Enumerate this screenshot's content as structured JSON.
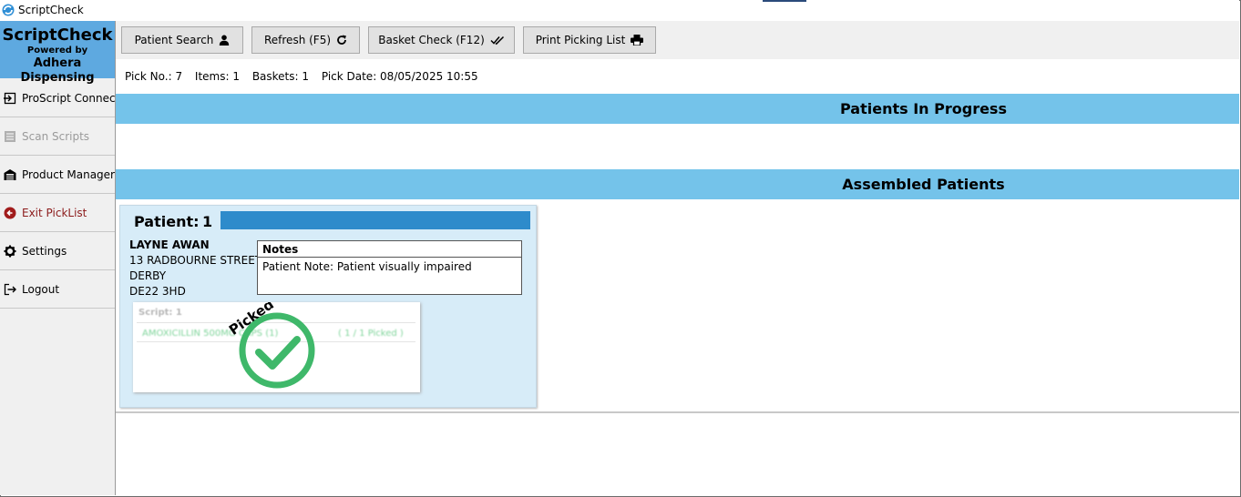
{
  "window": {
    "title": "ScriptCheck"
  },
  "brand": {
    "name": "ScriptCheck",
    "powered": "Powered by",
    "company": "Adhera Dispensing"
  },
  "sidebar": {
    "items": [
      {
        "label": "ProScript Connect",
        "icon": "login-arrow-icon",
        "enabled": true
      },
      {
        "label": "Scan Scripts",
        "icon": "barcode-list-icon",
        "enabled": false
      },
      {
        "label": "Product Manager",
        "icon": "warehouse-icon",
        "enabled": true
      },
      {
        "label": "Exit PickList",
        "icon": "back-circle-icon",
        "enabled": true
      },
      {
        "label": "Settings",
        "icon": "gear-icon",
        "enabled": true
      },
      {
        "label": "Logout",
        "icon": "logout-icon",
        "enabled": true
      }
    ]
  },
  "toolbar": {
    "patient_search": "Patient Search",
    "refresh": "Refresh (F5)",
    "basket_check": "Basket Check (F12)",
    "print_picking": "Print Picking List"
  },
  "pick": {
    "pick_no": "Pick No.: 7",
    "items": "Items: 1",
    "baskets": "Baskets: 1",
    "pick_date": "Pick Date: 08/05/2025 10:55"
  },
  "sections": {
    "in_progress": "Patients In Progress",
    "assembled": "Assembled Patients"
  },
  "patient": {
    "label": "Patient:",
    "number": "1",
    "name": "LAYNE AWAN",
    "address1": "13 RADBOURNE STREET",
    "address2": "DERBY",
    "postcode": "DE22 3HD",
    "notes_title": "Notes",
    "note": "Patient Note:  Patient visually impaired",
    "script": {
      "title": "Script: 1",
      "drug": "AMOXICILLIN 500MG CAPS (1)",
      "qty": "( 1 / 1 Picked )",
      "status": "Picked"
    }
  },
  "colors": {
    "accent": "#74c3ea",
    "brand": "#5ea9e0",
    "progress": "#2e8bcb",
    "picked": "#3fb86a"
  }
}
